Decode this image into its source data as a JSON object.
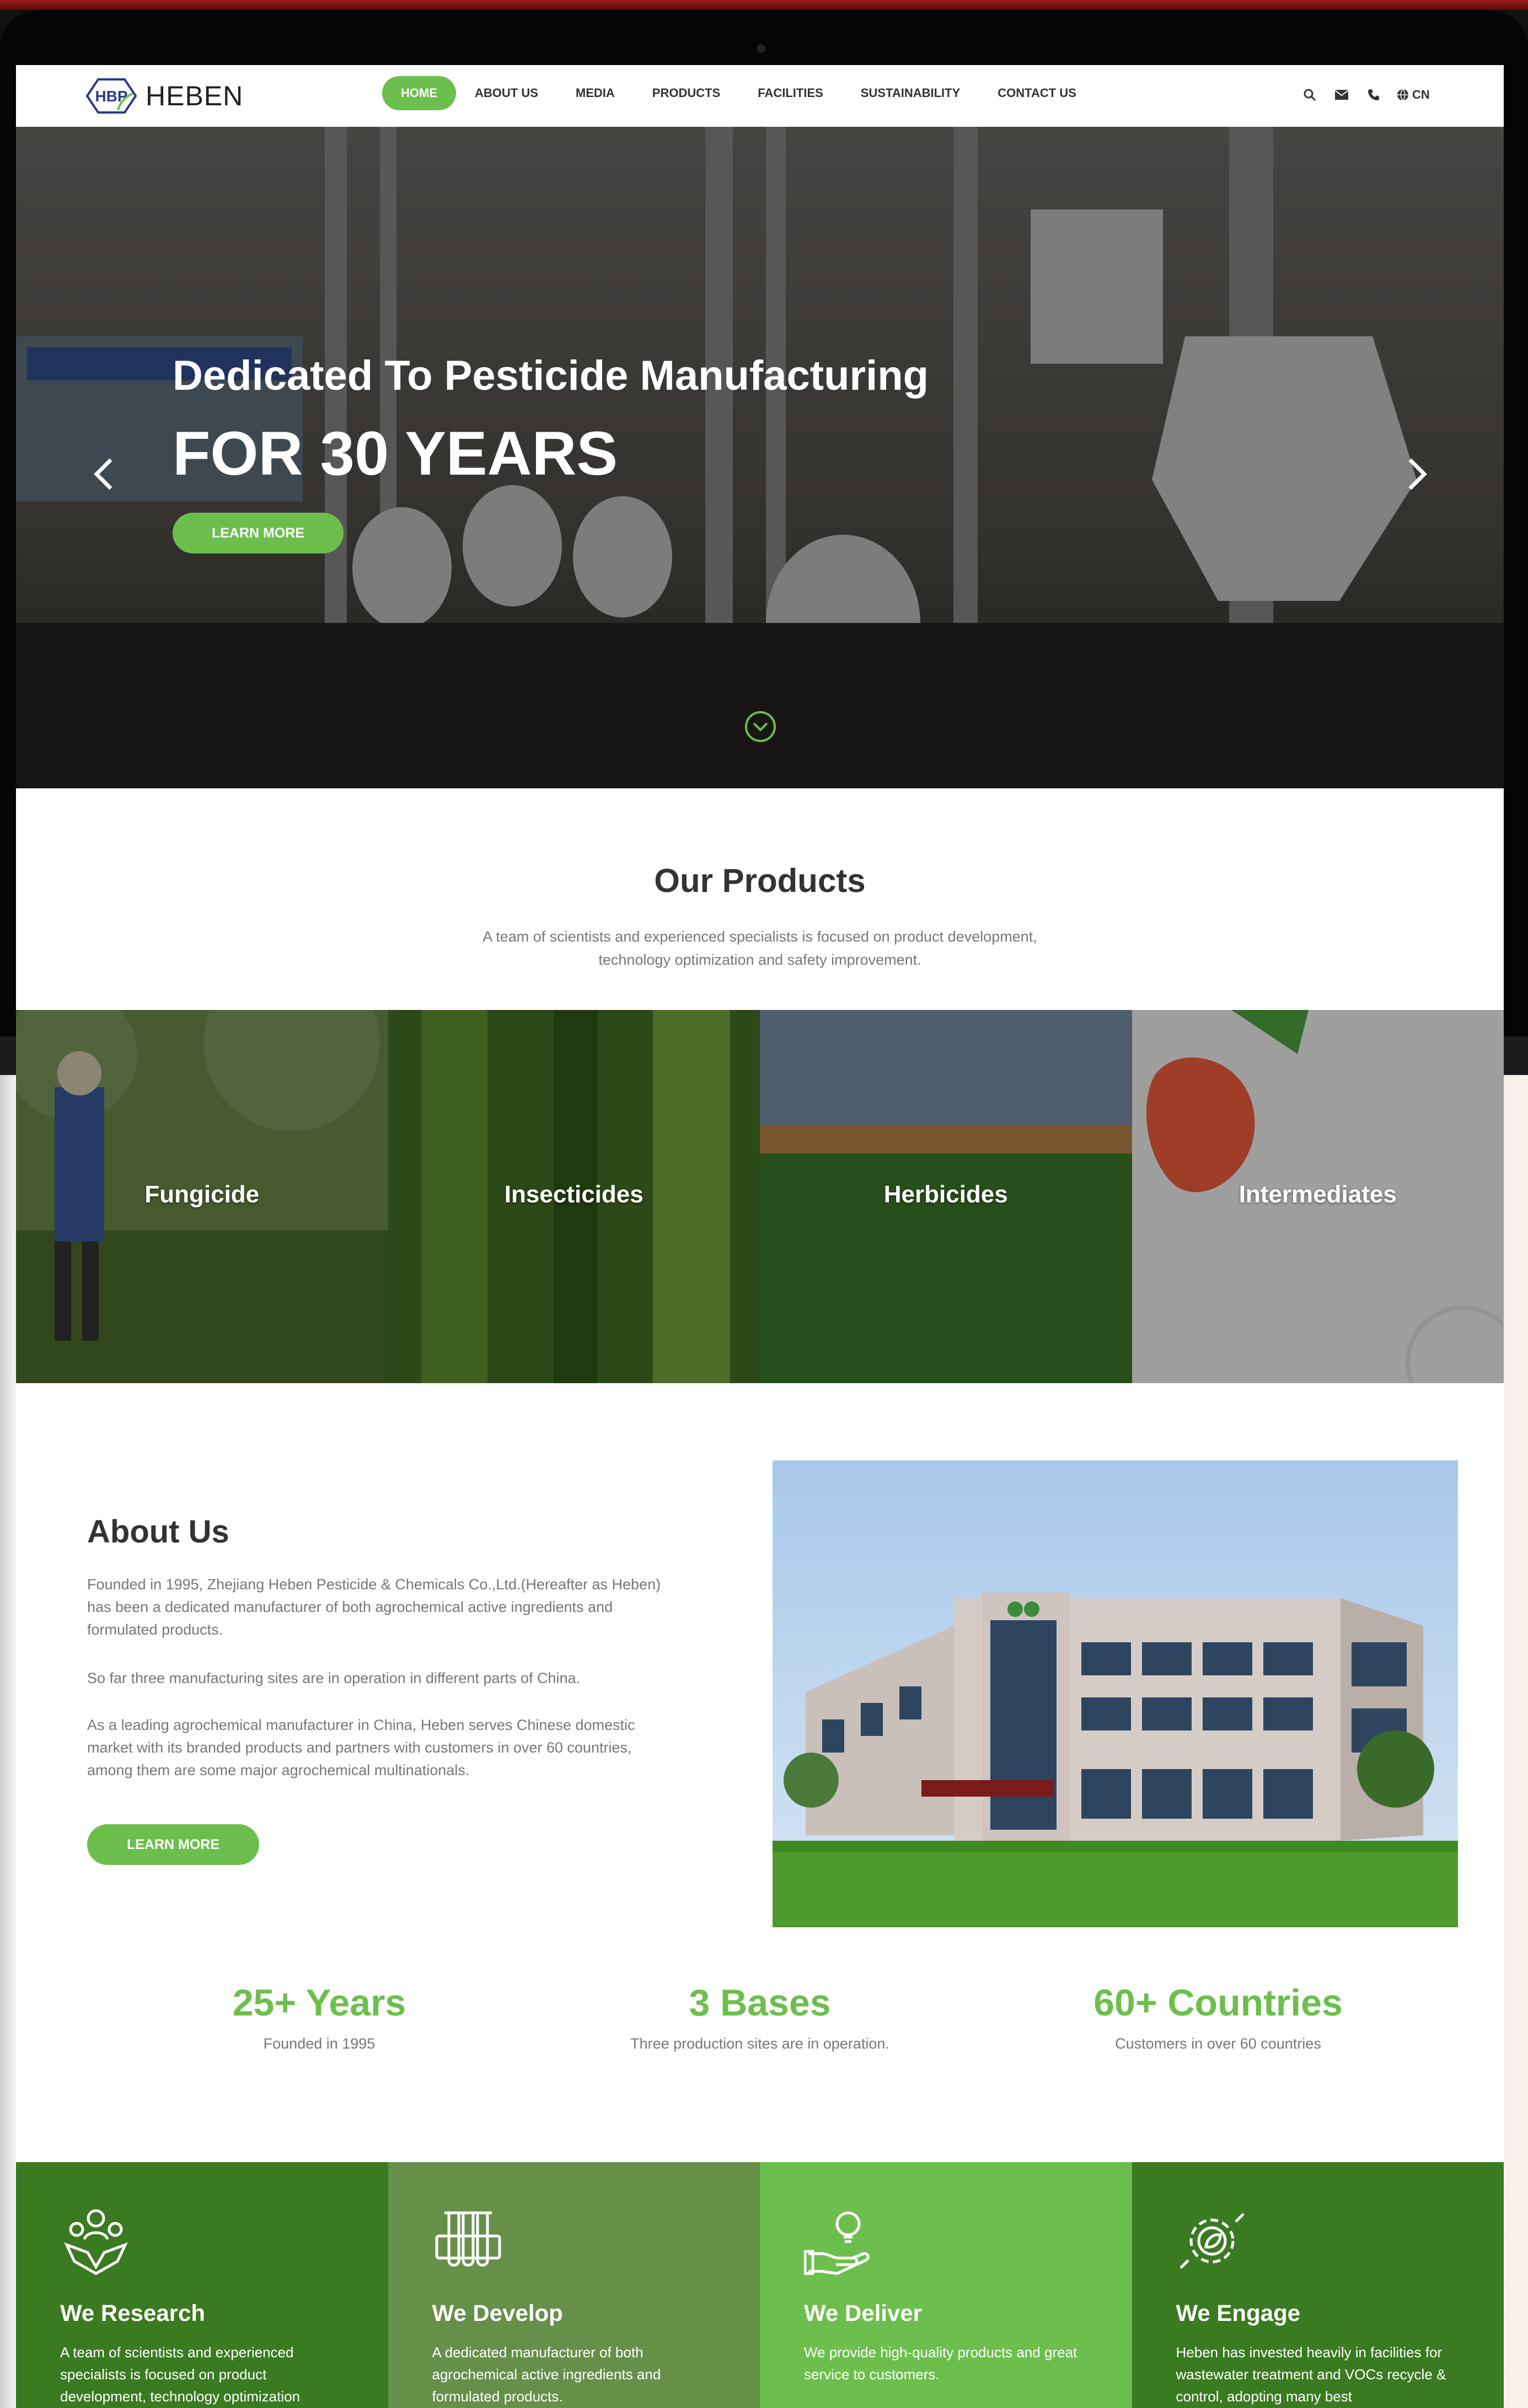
{
  "brand": {
    "logo_text": "HEBEN",
    "logo_mark": "HBP",
    "green": "#6cbf4c",
    "dark_green": "#3a7a20"
  },
  "nav": {
    "items": [
      {
        "label": "HOME",
        "active": true
      },
      {
        "label": "ABOUT US"
      },
      {
        "label": "MEDIA"
      },
      {
        "label": "PRODUCTS"
      },
      {
        "label": "FACILITIES"
      },
      {
        "label": "SUSTAINABILITY"
      },
      {
        "label": "CONTACT US"
      }
    ],
    "tools": [
      "search-icon",
      "mail-icon",
      "phone-icon"
    ],
    "lang": "CN"
  },
  "hero": {
    "subtitle": "Dedicated To Pesticide Manufacturing",
    "title": "FOR 30 YEARS",
    "button": "LEARN MORE"
  },
  "products": {
    "title": "Our Products",
    "desc_line1": "A team of scientists and experienced specialists is focused on product development,",
    "desc_line2": "technology optimization and safety improvement.",
    "tiles": [
      {
        "label": "Fungicide"
      },
      {
        "label": "Insecticides"
      },
      {
        "label": "Herbicides"
      },
      {
        "label": "Intermediates"
      }
    ]
  },
  "about": {
    "title": "About Us",
    "p1_l1": "Founded in 1995, Zhejiang Heben Pesticide & Chemicals Co.,Ltd.(Hereafter as Heben)",
    "p1_l2": "has been a dedicated manufacturer of both agrochemical active ingredients and",
    "p1_l3": "formulated products.",
    "p2": "So far three manufacturing sites are in operation in different parts of China.",
    "p3_l1": "As a leading agrochemical manufacturer in China, Heben serves Chinese domestic",
    "p3_l2": "market with its branded products and partners with customers in over 60 countries,",
    "p3_l3": "among them are some major agrochemical multinationals.",
    "button": "LEARN MORE"
  },
  "stats": [
    {
      "value": "25+ Years",
      "caption": "Founded in 1995"
    },
    {
      "value": "3 Bases",
      "caption": "Three production sites are in operation."
    },
    {
      "value": "60+ Countries",
      "caption": "Customers in over 60 countries"
    }
  ],
  "features": [
    {
      "icon": "team-icon",
      "title": "We Research",
      "text": "A team of scientists and experienced specialists is focused on product development, technology optimization"
    },
    {
      "icon": "test-tubes-icon",
      "title": "We Develop",
      "text": "A dedicated manufacturer of both agrochemical active ingredients and formulated products."
    },
    {
      "icon": "hand-lightbulb-icon",
      "title": "We Deliver",
      "text": "We provide high-quality products and great service to customers."
    },
    {
      "icon": "gear-leaf-icon",
      "title": "We Engage",
      "text": "Heben has invested heavily in facilities for wastewater treatment and VOCs recycle & control, adopting many best"
    }
  ]
}
